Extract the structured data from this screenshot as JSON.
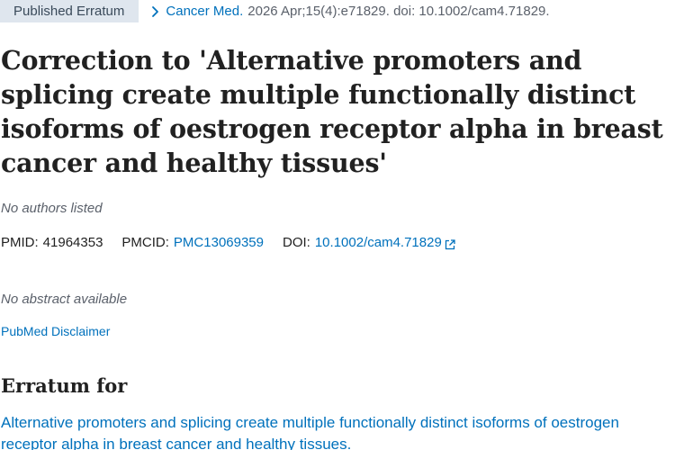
{
  "header": {
    "publication_type": "Published Erratum",
    "journal": "Cancer Med.",
    "citation": "2026 Apr;15(4):e71829. doi: 10.1002/cam4.71829."
  },
  "article": {
    "title": "Correction to 'Alternative promoters and splicing create multiple functionally distinct isoforms of oestrogen receptor alpha in breast cancer and healthy tissues'",
    "authors": "No authors listed",
    "identifiers": {
      "pmid_label": "PMID:",
      "pmid": "41964353",
      "pmcid_label": "PMCID:",
      "pmcid": "PMC13069359",
      "doi_label": "DOI:",
      "doi": "10.1002/cam4.71829"
    },
    "abstract_status": "No abstract available",
    "disclaimer_link": "PubMed Disclaimer"
  },
  "erratum_for": {
    "heading": "Erratum for",
    "link_text": "Alternative promoters and splicing create multiple functionally distinct isoforms of oestrogen receptor alpha in breast cancer and healthy tissues."
  },
  "icons": {
    "citation_arrow": "chevron-right-icon",
    "doi_external": "external-link-icon"
  },
  "colors": {
    "link": "#0071bc",
    "badge_bg": "#dfe6ee",
    "muted_text": "#5b616b",
    "body_text": "#212121"
  }
}
